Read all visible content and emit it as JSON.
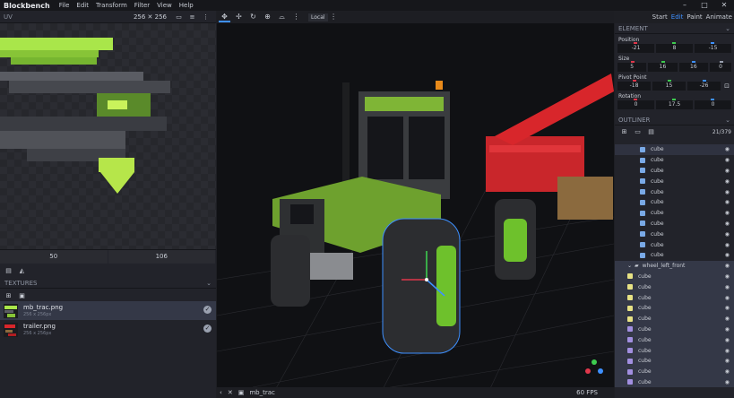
{
  "app": {
    "title": "Blockbench"
  },
  "menu": [
    "File",
    "Edit",
    "Transform",
    "Filter",
    "View",
    "Help"
  ],
  "window_controls": [
    "–",
    "□",
    "✕"
  ],
  "uv": {
    "label": "UV",
    "size": "256 ✕ 256",
    "footer": [
      "50",
      "106"
    ]
  },
  "textures": {
    "label": "TEXTURES",
    "items": [
      {
        "name": "mb_trac.png",
        "dim": "256 x 256px"
      },
      {
        "name": "trailer.png",
        "dim": "256 x 256px"
      }
    ]
  },
  "viewport": {
    "space": "Local",
    "file": "mb_trac",
    "fps": "60 FPS"
  },
  "modes": [
    "Start",
    "Edit",
    "Paint",
    "Animate"
  ],
  "active_mode": "Edit",
  "element": {
    "label": "ELEMENT",
    "position": {
      "label": "Position",
      "values": [
        "-21",
        "8",
        "-15"
      ]
    },
    "size": {
      "label": "Size",
      "values": [
        "5",
        "16",
        "16",
        "0"
      ]
    },
    "pivot": {
      "label": "Pivot Point",
      "values": [
        "-18",
        "15",
        "-26"
      ]
    },
    "rotation": {
      "label": "Rotation",
      "values": [
        "0",
        "17.5",
        "0"
      ]
    }
  },
  "outliner": {
    "label": "OUTLINER",
    "count": "21/379",
    "group_name": "wheel_left_front",
    "cube_label": "cube"
  },
  "colors": {
    "accent": "#3e90ff",
    "x": "#e0374b",
    "y": "#3dcc4f",
    "z": "#3e90ff"
  }
}
